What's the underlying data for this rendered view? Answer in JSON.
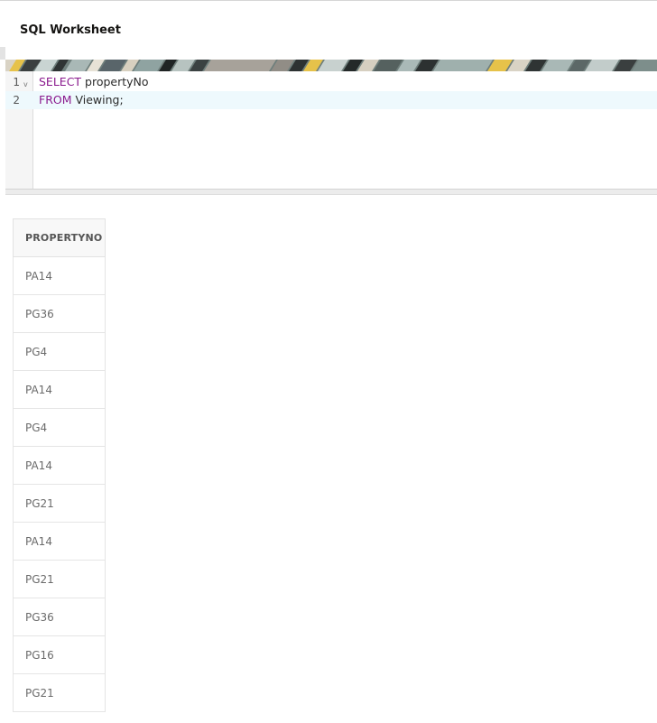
{
  "worksheet": {
    "title": "SQL Worksheet"
  },
  "editor": {
    "lines": [
      {
        "number": "1",
        "keyword": "SELECT",
        "rest": " propertyNo"
      },
      {
        "number": "2",
        "keyword": "FROM",
        "rest": " Viewing;"
      }
    ],
    "fold_icon": "chevron-down-icon",
    "fold_glyph": "v"
  },
  "results": {
    "columns": [
      "PROPERTYNO"
    ],
    "rows": [
      "PA14",
      "PG36",
      "PG4",
      "PA14",
      "PG4",
      "PA14",
      "PG21",
      "PA14",
      "PG21",
      "PG36",
      "PG16",
      "PG21"
    ]
  },
  "colors": {
    "keyword": "#8a1a8e",
    "active_line": "#eef9fd"
  }
}
